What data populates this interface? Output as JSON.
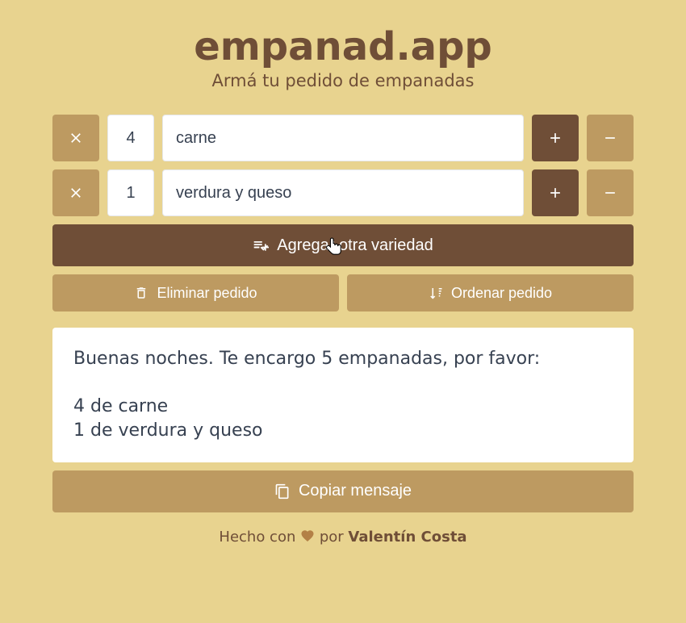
{
  "header": {
    "title": "empanad.app",
    "subtitle": "Armá tu pedido de empanadas"
  },
  "rows": [
    {
      "qty": "4",
      "variety": "carne"
    },
    {
      "qty": "1",
      "variety": "verdura y queso"
    }
  ],
  "buttons": {
    "add": "Agregar otra variedad",
    "clear": "Eliminar pedido",
    "sort": "Ordenar pedido",
    "copy": "Copiar mensaje"
  },
  "message": "Buenas noches. Te encargo 5 empanadas, por favor:\n\n4 de carne\n1 de verdura y queso",
  "footer": {
    "prefix": "Hecho con ",
    "mid": " por ",
    "author": "Valentín Costa"
  }
}
